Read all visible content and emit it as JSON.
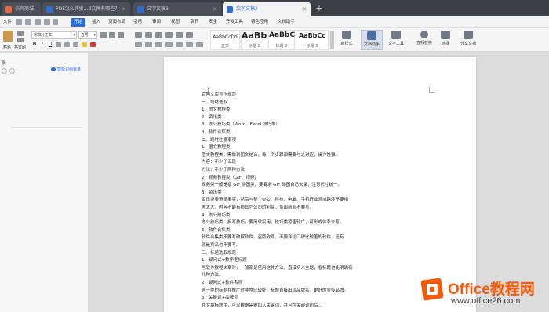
{
  "tabs": [
    {
      "label": "稻壳商城",
      "icon_color": "#f0653a"
    },
    {
      "label": "PDF怎么转换...d文件有哪些？",
      "icon_color": "#2b6fd6"
    },
    {
      "label": "文字文稿3",
      "icon_color": "#2b6fd6"
    },
    {
      "label": "文字文稿2",
      "icon_color": "#2b6fd6"
    }
  ],
  "menu": [
    "文件",
    "开始",
    "插入",
    "页面布局",
    "引用",
    "审阅",
    "视图",
    "章节",
    "安全",
    "开发工具",
    "特色应用",
    "文档助手"
  ],
  "ribbon": {
    "paste": "粘贴",
    "format_painter": "格式刷",
    "font_name": "宋体 (正文)",
    "font_size": "五号",
    "styles": [
      {
        "preview": "AaBbCcDd",
        "label": "正文"
      },
      {
        "preview": "AaBb",
        "label": "标题 1"
      },
      {
        "preview": "AaBbC",
        "label": "标题 2"
      },
      {
        "preview": "AaBbCc",
        "label": "标题 3"
      }
    ],
    "new_style": "新样式",
    "doc_assistant": "文档助手",
    "text_tools": "文字工具",
    "find_replace": "查找替换",
    "select": "选择",
    "share": "分享文档"
  },
  "left_pane": {
    "title": "录",
    "smart": "智能识别目录"
  },
  "document": {
    "lines": [
      "百问文库写作规范",
      "一、题材选取",
      "1、图文教程类",
      "2、资讯类",
      "3、办公技巧类（Word、Excel 技巧等）",
      "4、软件合集类",
      "二、题材注意事项",
      "1、图文教程类",
      "图文教程类，需做到图文结合，每一个步骤都需要与之对应，操作性强。",
      "内容：不少于五段",
      "方法：不少于两种方法",
      "2、视频教程类（GIF、视频）",
      "视频类一般是指 GIF 动图类，要要求 GIF 动图自己去录，注意尺寸统一。",
      "3、资讯类",
      "资讯类要遵循事实，然后与整个办公、科技、电脑、手机行业领域跨度不要相",
      "差太大，内容不能有损其它公司的利益，负面新闻不要写。",
      "4、办公技巧类",
      "办公技巧类，拆写技巧，要简单实用，技巧类范围较广，可形成体系去写。",
      "5、软件合集类",
      "软件合集类不要写破解软件，盗版软件，不要评论口碑比较差的软件，还有",
      "就是竞品也不要写。",
      "三、标题选取规范",
      "1、疑问式+数字型标题",
      "写软件教程文章时，一般都是使用这种方法，直接切入主题，看标题也能明确有",
      "几种方法。",
      "2、疑问式+软件名称",
      "这一类的标题在推广时非常比较好，标题直接出现品牌名，更好的宣传品牌。",
      "3、关键词+品牌词",
      "在文章标题中，可以根据需要加入关键词，并且在关键词前后..."
    ]
  },
  "watermark": {
    "name": "Office教程网",
    "url": "www.office26.com"
  }
}
